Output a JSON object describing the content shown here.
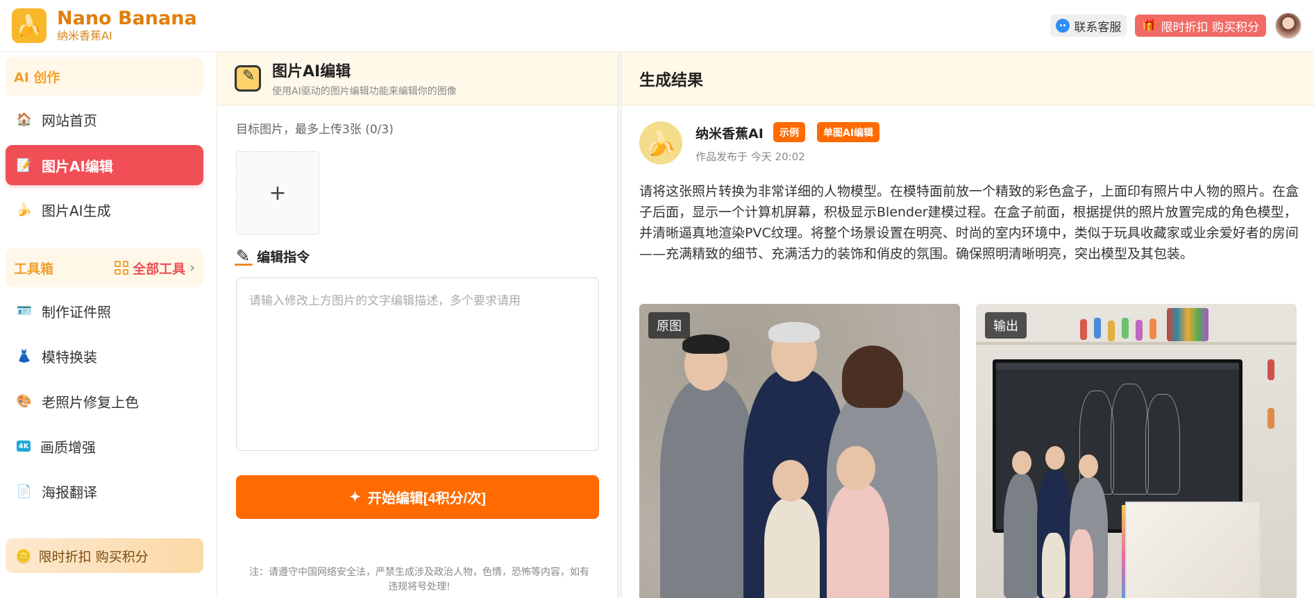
{
  "header": {
    "brand_name": "Nano Banana",
    "brand_sub": "纳米香蕉AI",
    "contact_label": "联系客服",
    "promo_label": "限时折扣 购买积分"
  },
  "sidebar": {
    "section_ai": "AI 创作",
    "items_ai": [
      {
        "label": "网站首页",
        "icon": "home-icon"
      },
      {
        "label": "图片AI编辑",
        "icon": "edit-icon",
        "active": true
      },
      {
        "label": "图片AI生成",
        "icon": "banana-icon"
      }
    ],
    "section_tools": "工具箱",
    "all_tools_label": "全部工具",
    "items_tools": [
      {
        "label": "制作证件照",
        "icon": "id-card-icon"
      },
      {
        "label": "模特换装",
        "icon": "dress-icon"
      },
      {
        "label": "老照片修复上色",
        "icon": "palette-icon"
      },
      {
        "label": "画质增强",
        "icon": "4k-icon"
      },
      {
        "label": "海报翻译",
        "icon": "translate-icon"
      }
    ],
    "promo_label": "限时折扣 购买积分"
  },
  "editor": {
    "title": "图片AI编辑",
    "subtitle": "使用AI驱动的图片编辑功能来编辑你的图像",
    "target_label": "目标图片，最多上传3张 (0/3)",
    "upload_plus": "+",
    "instruction_label": "编辑指令",
    "instruction_placeholder": "请输入修改上方图片的文字编辑描述，多个要求请用",
    "start_button": "开始编辑[4积分/次]",
    "note": "注：请遵守中国网络安全法，严禁生成涉及政治人物，色情，恐怖等内容，如有违规将号处理!"
  },
  "result": {
    "title": "生成结果",
    "author": "纳米香蕉AI",
    "badge_example": "示例",
    "badge_mode": "单图AI编辑",
    "published": "作品发布于 今天 20:02",
    "prompt": "请将这张照片转换为非常详细的人物模型。在模特面前放一个精致的彩色盒子，上面印有照片中人物的照片。在盒子后面，显示一个计算机屏幕，积极显示Blender建模过程。在盒子前面，根据提供的照片放置完成的角色模型，并清晰逼真地渲染PVC纹理。将整个场景设置在明亮、时尚的室内环境中，类似于玩具收藏家或业余爱好者的房间——充满精致的细节、充满活力的装饰和俏皮的氛围。确保照明清晰明亮，突出模型及其包装。",
    "tag_original": "原图",
    "tag_output": "输出"
  },
  "colors": {
    "brand": "#e07f0c",
    "accent_red": "#f04f56",
    "accent_orange": "#ff6b00"
  }
}
